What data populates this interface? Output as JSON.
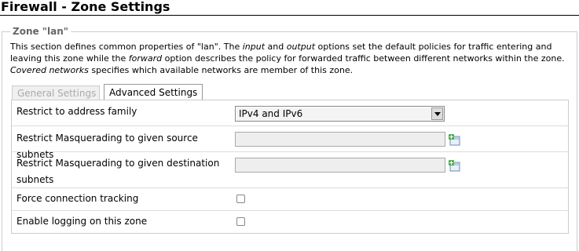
{
  "page": {
    "title": "Firewall - Zone Settings"
  },
  "zone": {
    "legend": "Zone \"lan\"",
    "description": {
      "p1": "This section defines common properties of \"lan\". The ",
      "input": "input",
      "p2": " and ",
      "output": "output",
      "p3": " options set the default policies for traffic entering and leaving this zone while the ",
      "forward": "forward",
      "p4": " option describes the policy for forwarded traffic between different networks within the zone. ",
      "covered": "Covered networks",
      "p5": " specifies which available networks are member of this zone."
    }
  },
  "tabs": [
    {
      "label": "General Settings",
      "active": false
    },
    {
      "label": "Advanced Settings",
      "active": true
    }
  ],
  "fields": {
    "family": {
      "label": "Restrict to address family",
      "value": "IPv4 and IPv6"
    },
    "masq_src": {
      "label": "Restrict Masquerading to given source subnets",
      "value": ""
    },
    "masq_dest": {
      "label": "Restrict Masquerading to given destination subnets",
      "value": ""
    },
    "conntrack": {
      "label": "Force connection tracking",
      "checked": false
    },
    "log": {
      "label": "Enable logging on this zone",
      "checked": false
    }
  },
  "icons": {
    "add": "add-subnet-icon"
  }
}
